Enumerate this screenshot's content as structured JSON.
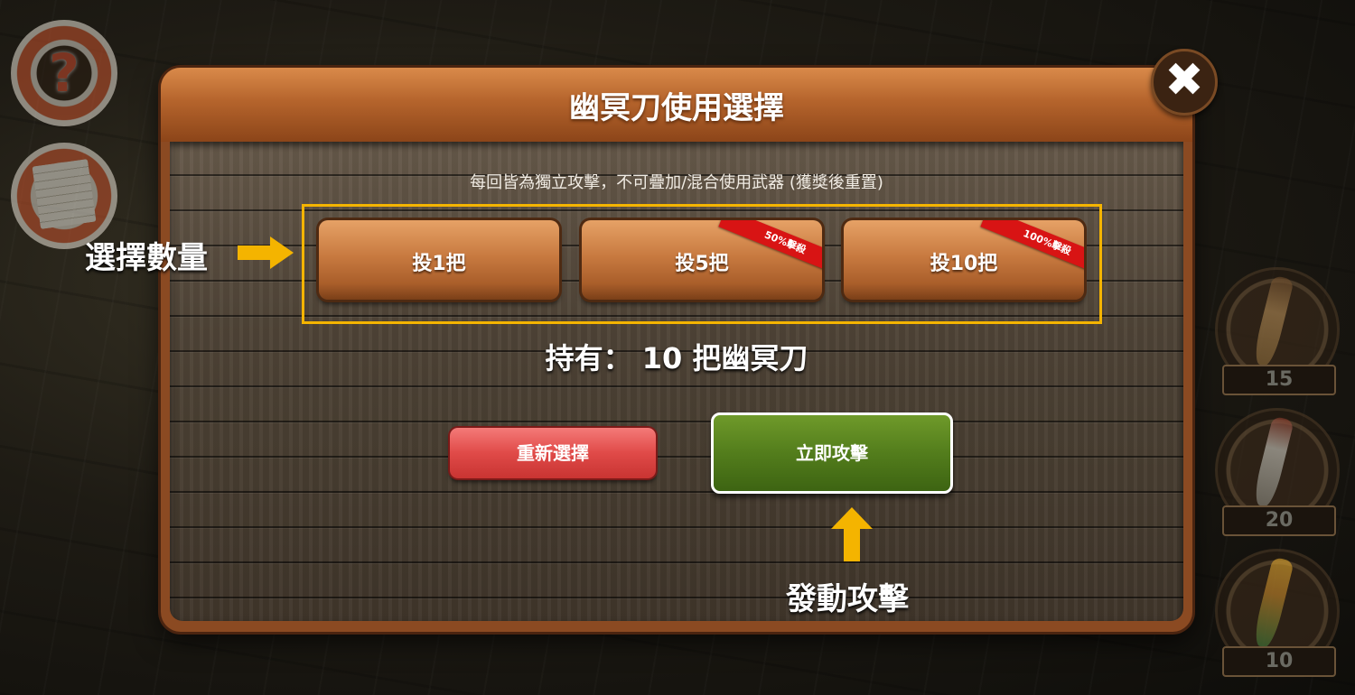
{
  "dialog": {
    "title": "幽冥刀使用選擇",
    "notice": "每回皆為獨立攻擊，不可疊加/混合使用武器 (獲獎後重置)",
    "quantity_options": [
      {
        "label": "投1把",
        "ribbon": ""
      },
      {
        "label": "投5把",
        "ribbon": "50%擊殺"
      },
      {
        "label": "投10把",
        "ribbon": "100%擊殺"
      }
    ],
    "owned_text": "持有： 10 把幽冥刀",
    "reset_label": "重新選擇",
    "attack_label": "立即攻擊",
    "close_glyph": "✖"
  },
  "annotations": {
    "select_quantity": "選擇數量",
    "launch_attack": "發動攻擊"
  },
  "left_buttons": {
    "help_glyph": "?"
  },
  "weapon_slots": [
    {
      "icon": "dagger-icon",
      "count": "15"
    },
    {
      "icon": "sword-icon",
      "count": "20"
    },
    {
      "icon": "golden-sword-icon",
      "count": "10"
    }
  ],
  "colors": {
    "highlight": "#f4b400",
    "ribbon": "#d81414",
    "reset_button": "#e04a48",
    "attack_button": "#537d1c"
  }
}
